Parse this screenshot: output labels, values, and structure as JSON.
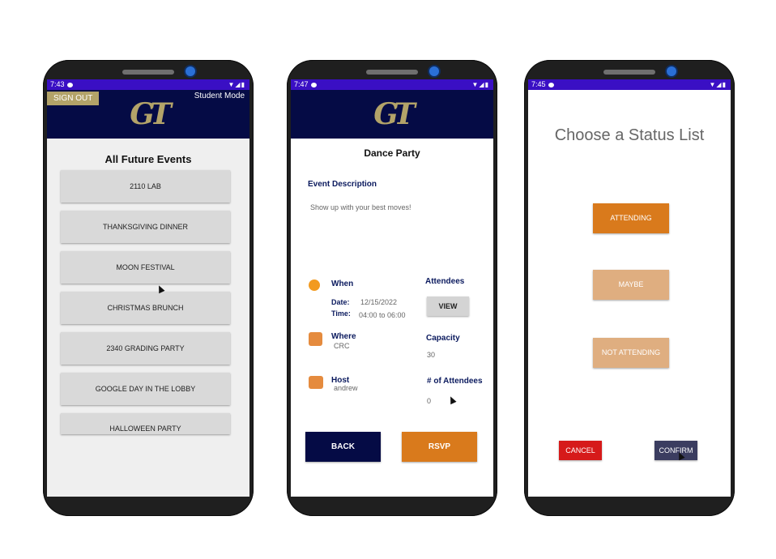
{
  "phone1": {
    "time": "7:43",
    "sign_out": "SIGN OUT",
    "mode": "Student Mode",
    "logo": "GT",
    "title": "All Future Events",
    "events": [
      "2110 LAB",
      "THANKSGIVING DINNER",
      "MOON FESTIVAL",
      "CHRISTMAS BRUNCH",
      "2340 GRADING PARTY",
      "GOOGLE DAY IN THE LOBBY",
      "HALLOWEEN PARTY"
    ]
  },
  "phone2": {
    "time": "7:47",
    "logo": "GT",
    "event_title": "Dance Party",
    "description_label": "Event Description",
    "description": "Show up with your best moves!",
    "when_label": "When",
    "date_label": "Date:",
    "date_value": "12/15/2022",
    "time_label": "Time:",
    "time_value": "04:00 to 06:00",
    "where_label": "Where",
    "where_value": "CRC",
    "host_label": "Host",
    "host_value": "andrew",
    "attendees_label": "Attendees",
    "view_button": "VIEW",
    "capacity_label": "Capacity",
    "capacity_value": "30",
    "num_attendees_label": "# of Attendees",
    "num_attendees_value": "0",
    "back_button": "BACK",
    "rsvp_button": "RSVP"
  },
  "phone3": {
    "time": "7:45",
    "heading": "Choose a Status List",
    "attending": "ATTENDING",
    "maybe": "MAYBE",
    "not_attending": "NOT ATTENDING",
    "cancel": "CANCEL",
    "confirm": "CONFIRM"
  },
  "colors": {
    "gt_navy": "#050b45",
    "gt_gold": "#b3a369",
    "status_bar": "#3a0fc4",
    "orange": "#d97a1c",
    "orange_light": "#dfae80",
    "cancel_red": "#d61a1a",
    "confirm_navy": "#3b3d60"
  }
}
